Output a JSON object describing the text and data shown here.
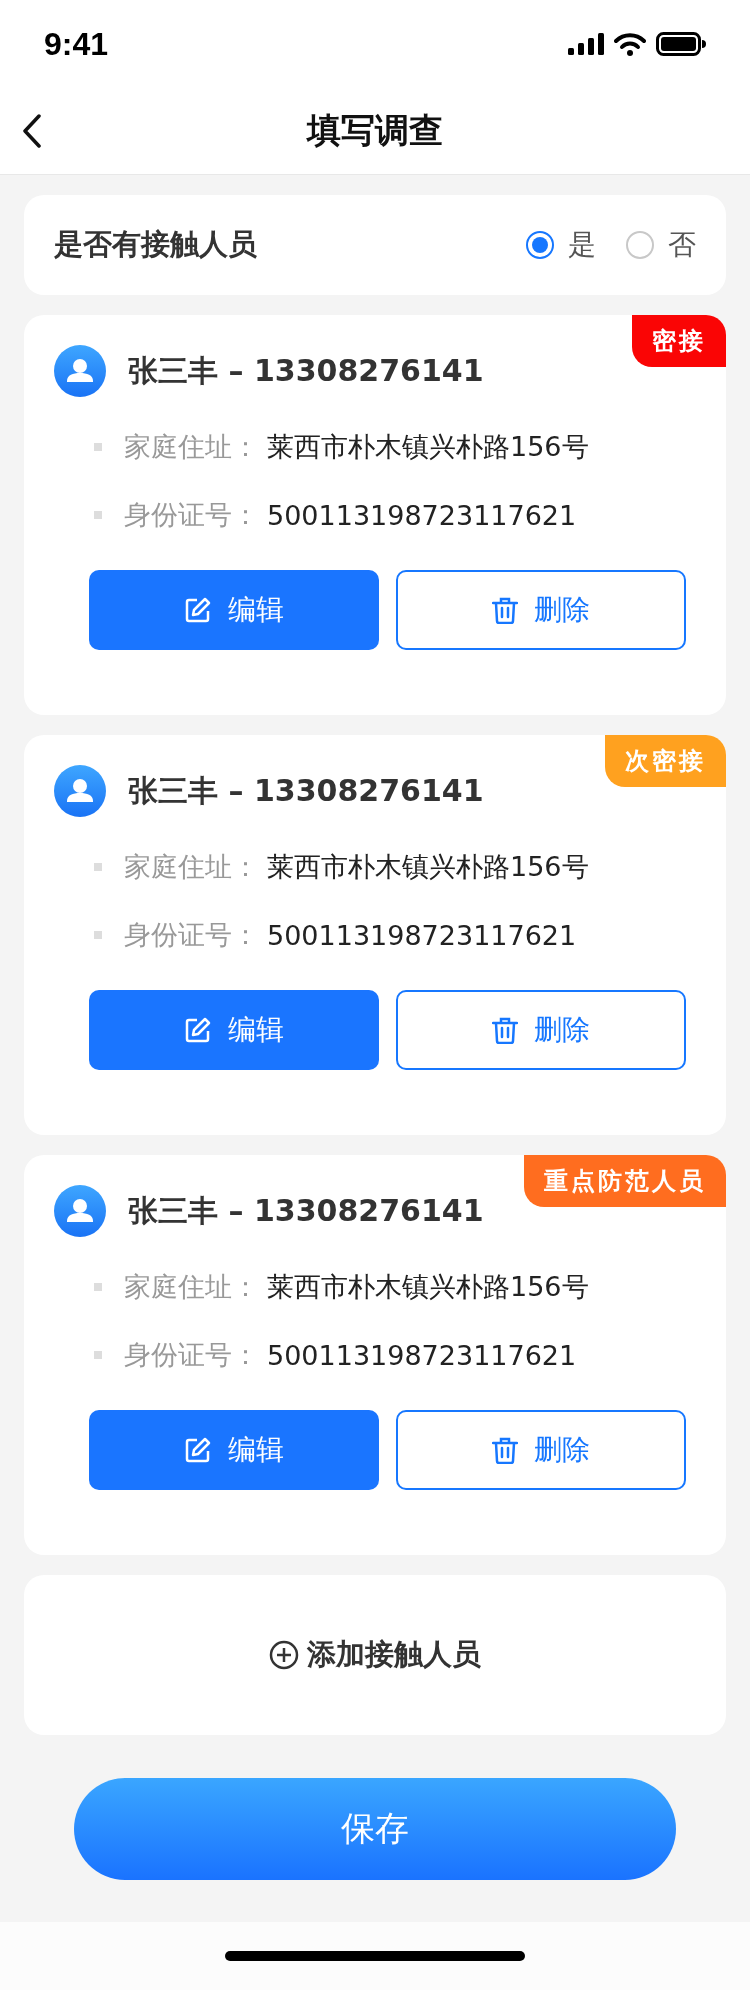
{
  "status_bar": {
    "time": "9:41"
  },
  "nav": {
    "title": "填写调查"
  },
  "question": {
    "label": "是否有接触人员",
    "options": [
      {
        "label": "是",
        "selected": true
      },
      {
        "label": "否",
        "selected": false
      }
    ]
  },
  "contacts": [
    {
      "name": "张三丰 – 13308276141",
      "tag": "密接",
      "color": "#fa0505",
      "fields": [
        {
          "label": "家庭住址：",
          "value": "莱西市朴木镇兴朴路156号"
        },
        {
          "label": "身份证号：",
          "value": "500113198723117621"
        }
      ],
      "edit": "编辑",
      "delete": "删除"
    },
    {
      "name": "张三丰 – 13308276141",
      "tag": "次密接",
      "color": "#ffa11f",
      "fields": [
        {
          "label": "家庭住址：",
          "value": "莱西市朴木镇兴朴路156号"
        },
        {
          "label": "身份证号：",
          "value": "500113198723117621"
        }
      ],
      "edit": "编辑",
      "delete": "删除"
    },
    {
      "name": "张三丰 – 13308276141",
      "tag": "重点防范人员",
      "color": "#ff6d1f",
      "fields": [
        {
          "label": "家庭住址：",
          "value": "莱西市朴木镇兴朴路156号"
        },
        {
          "label": "身份证号：",
          "value": "500113198723117621"
        }
      ],
      "edit": "编辑",
      "delete": "删除"
    }
  ],
  "add_button": "添加接触人员",
  "save_button": "保存"
}
